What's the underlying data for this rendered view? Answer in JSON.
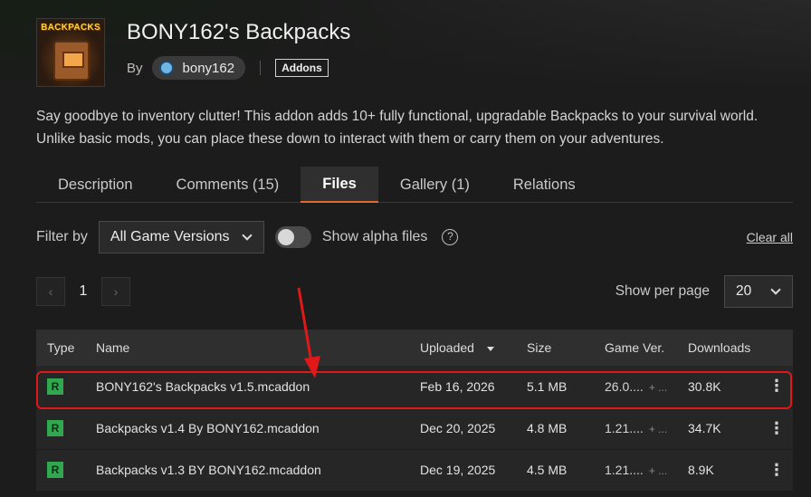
{
  "project": {
    "logo_text": "BACKPACKS",
    "title": "BONY162's Backpacks",
    "by_label": "By",
    "author": "bony162",
    "category": "Addons",
    "description_line1": "Say goodbye to inventory clutter! This addon adds 10+ fully functional, upgradable Backpacks to your survival world.",
    "description_line2": "Unlike basic mods, you can place these down to interact with them or carry them on your adventures."
  },
  "tabs": [
    {
      "label": "Description"
    },
    {
      "label": "Comments (15)"
    },
    {
      "label": "Files",
      "active": true
    },
    {
      "label": "Gallery (1)"
    },
    {
      "label": "Relations"
    }
  ],
  "filters": {
    "filter_by_label": "Filter by",
    "game_version": "All Game Versions",
    "alpha_label": "Show alpha files",
    "help_glyph": "?",
    "clear_all": "Clear all"
  },
  "pagination": {
    "prev": "‹",
    "current": "1",
    "next": "›",
    "per_page_label": "Show per page",
    "per_page_value": "20"
  },
  "table": {
    "headers": {
      "type": "Type",
      "name": "Name",
      "uploaded": "Uploaded",
      "size": "Size",
      "game_ver": "Game Ver.",
      "downloads": "Downloads"
    },
    "rows": [
      {
        "type": "R",
        "name": "BONY162's Backpacks v1.5.mcaddon",
        "uploaded": "Feb 16, 2026",
        "size": "5.1 MB",
        "game_ver": "26.0....",
        "plus": "+ ...",
        "downloads": "30.8K",
        "menu": "⋮"
      },
      {
        "type": "R",
        "name": "Backpacks v1.4 By BONY162.mcaddon",
        "uploaded": "Dec 20, 2025",
        "size": "4.8 MB",
        "game_ver": "1.21....",
        "plus": "+ ...",
        "downloads": "34.7K",
        "menu": "⋮"
      },
      {
        "type": "R",
        "name": "Backpacks v1.3 BY BONY162.mcaddon",
        "uploaded": "Dec 19, 2025",
        "size": "4.5 MB",
        "game_ver": "1.21....",
        "plus": "+ ...",
        "downloads": "8.9K",
        "menu": "⋮"
      }
    ]
  },
  "colors": {
    "accent": "#e06a35",
    "release_badge": "#2fa84f",
    "annotation_red": "#e01818"
  }
}
